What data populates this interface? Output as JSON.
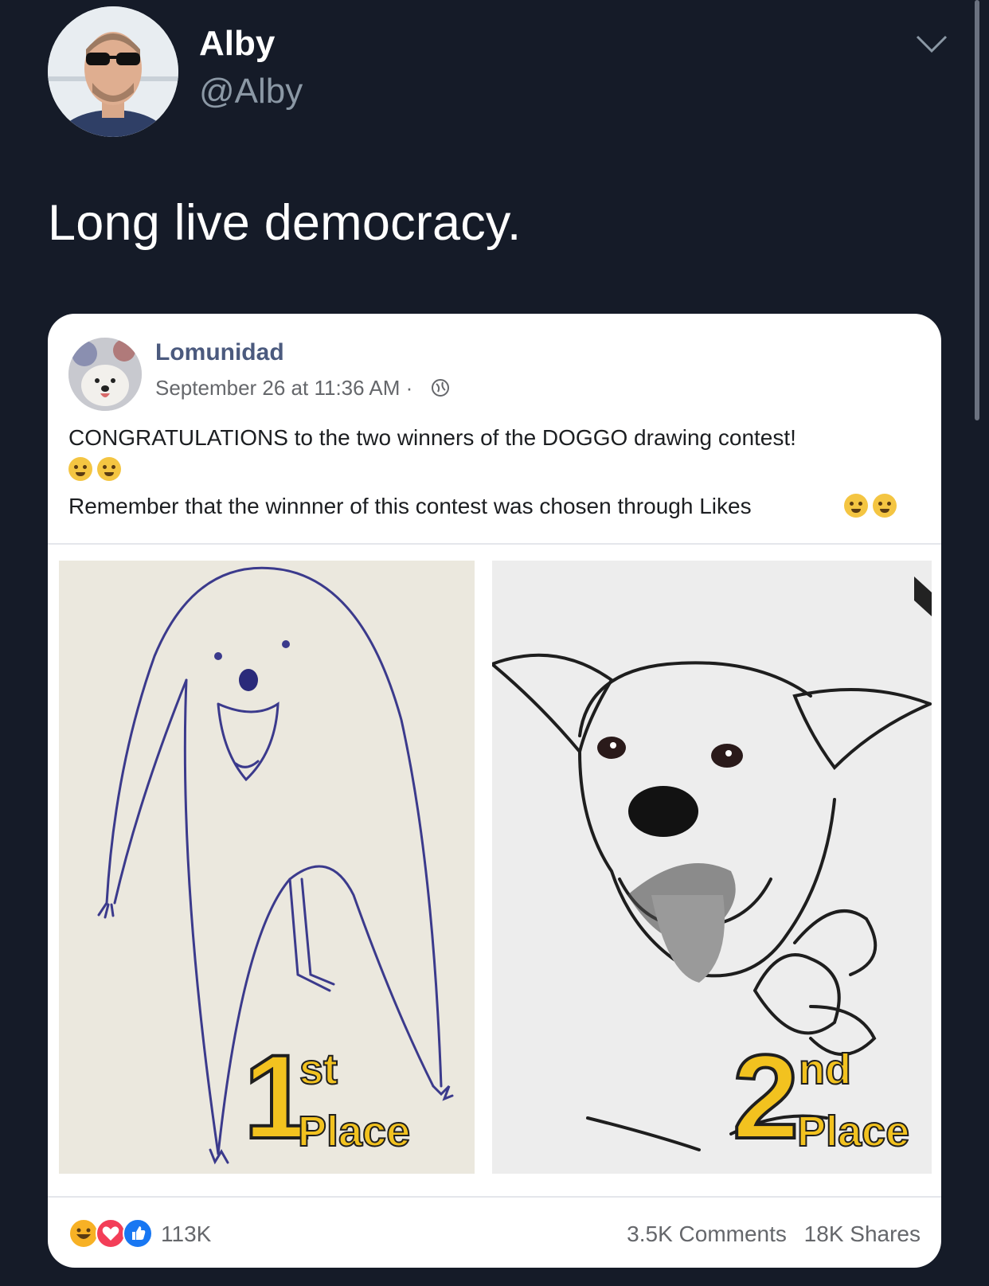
{
  "tweet": {
    "display_name": "Alby",
    "handle": "@Alby",
    "text": "Long live democracy."
  },
  "post": {
    "page_name": "Lomunidad",
    "date": "September 26 at 11:36 AM · ",
    "line1": "CONGRATULATIONS to the two winners of the DOGGO drawing contest!",
    "line2": "Remember that the winnner of this contest was chosen through Likes",
    "first_place": {
      "num": "1",
      "sup": "st",
      "word": "Place"
    },
    "second_place": {
      "num": "2",
      "sup": "nd",
      "word": "Place"
    },
    "reaction_count": "113K",
    "comments": "3.5K Comments",
    "shares": "18K Shares"
  },
  "icons": [
    "chevron-down-icon",
    "globe-icon",
    "haha-reaction-icon",
    "love-reaction-icon",
    "like-reaction-icon"
  ],
  "colors": {
    "background": "#151b28",
    "accent_yellow": "#f2c21f",
    "fb_blue": "#1877f2"
  }
}
